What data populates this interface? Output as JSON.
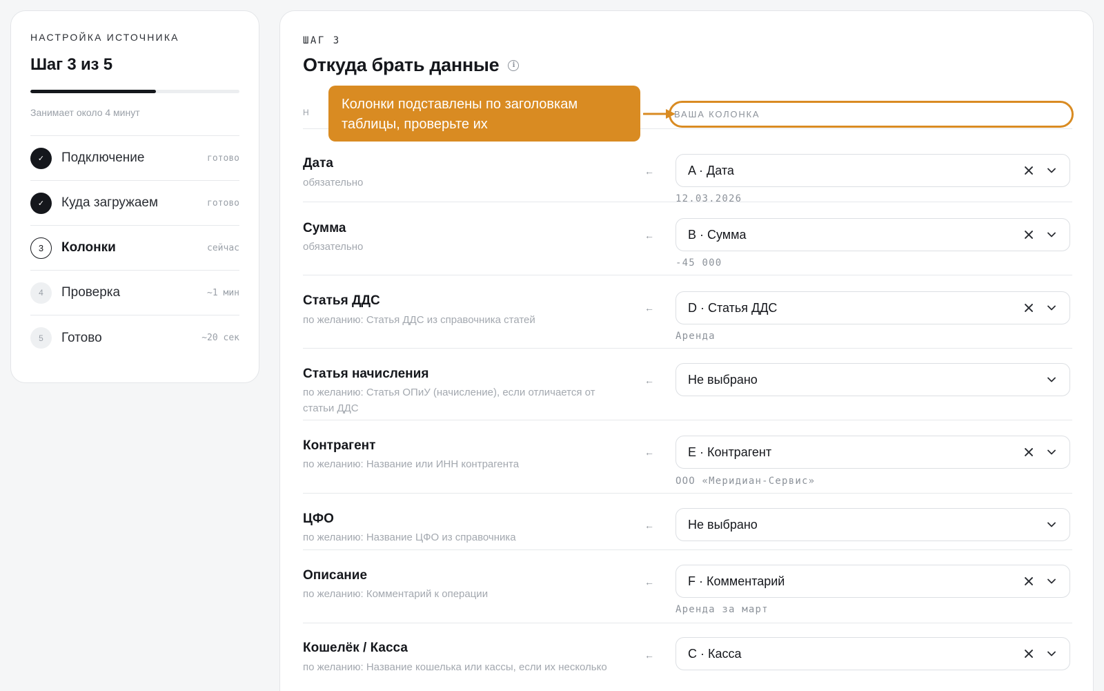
{
  "sidebar": {
    "kicker": "НАСТРОЙКА ИСТОЧНИКА",
    "title": "Шаг 3 из 5",
    "progress_fraction": 0.6,
    "hint": "Занимает около 4 минут",
    "steps": [
      {
        "marker": "✓",
        "label": "Подключение",
        "meta": "готово",
        "state": "done"
      },
      {
        "marker": "✓",
        "label": "Куда загружаем",
        "meta": "готово",
        "state": "done"
      },
      {
        "marker": "3",
        "label": "Колонки",
        "meta": "сейчас",
        "state": "current"
      },
      {
        "marker": "4",
        "label": "Проверка",
        "meta": "~1 мин",
        "state": "todo"
      },
      {
        "marker": "5",
        "label": "Готово",
        "meta": "~20 сек",
        "state": "todo"
      }
    ]
  },
  "main": {
    "kicker": "ШАГ 3",
    "title": "Откуда брать данные",
    "info_icon": "i",
    "header_left": "Н",
    "header_right": "ВАША КОЛОНКА",
    "tooltip": "Колонки подставлены по заголовкам таблицы, проверьте их",
    "accent_color": "#d98b22",
    "arrow_glyph": "←",
    "fields": [
      {
        "name": "Дата",
        "desc": "обязательно",
        "value": "A · Дата",
        "sample": "12.03.2026",
        "clearable": true
      },
      {
        "name": "Сумма",
        "desc": "обязательно",
        "value": "B · Сумма",
        "sample": "-45 000",
        "clearable": true
      },
      {
        "name": "Статья ДДС",
        "desc": "по желанию: Статья ДДС из справочника статей",
        "value": "D · Статья ДДС",
        "sample": "Аренда",
        "clearable": true
      },
      {
        "name": "Статья начисления",
        "desc": "по желанию: Статья ОПиУ (начисление), если отличается от статьи ДДС",
        "value": "Не выбрано",
        "sample": "",
        "clearable": false
      },
      {
        "name": "Контрагент",
        "desc": "по желанию: Название или ИНН контрагента",
        "value": "E · Контрагент",
        "sample": "ООО «Меридиан-Сервис»",
        "clearable": true
      },
      {
        "name": "ЦФО",
        "desc": "по желанию: Название ЦФО из справочника",
        "value": "Не выбрано",
        "sample": "",
        "clearable": false
      },
      {
        "name": "Описание",
        "desc": "по желанию: Комментарий к операции",
        "value": "F · Комментарий",
        "sample": "Аренда за март",
        "clearable": true
      },
      {
        "name": "Кошелёк / Касса",
        "desc": "по желанию: Название кошелька или кассы, если их несколько",
        "value": "C · Касса",
        "sample": "",
        "clearable": true
      }
    ]
  }
}
